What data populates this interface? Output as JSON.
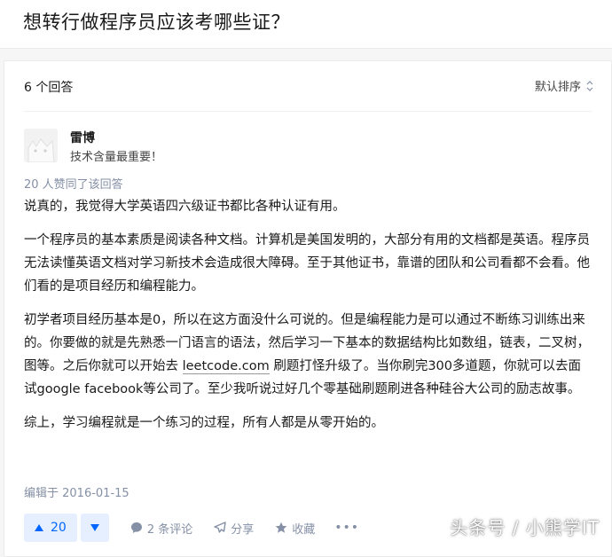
{
  "question": {
    "title": "想转行做程序员应该考哪些证？"
  },
  "answers_header": {
    "count_label": "6 个回答",
    "sort_label": "默认排序"
  },
  "answer": {
    "author": {
      "name": "雷博",
      "bio": "技术含量最重要！"
    },
    "votes_summary": "20 人赞同了该回答",
    "paragraphs": {
      "p1": "说真的，我觉得大学英语四六级证书都比各种认证有用。",
      "p2": "一个程序员的基本素质是阅读各种文档。计算机是美国发明的，大部分有用的文档都是英语。程序员无法读懂英语文档对学习新技术会造成很大障碍。至于其他证书，靠谱的团队和公司看都不会看。他们看的是项目经历和编程能力。",
      "p3_before_link": "初学者项目经历基本是0，所以在这方面没什么可说的。但是编程能力是可以通过不断练习训练出来的。你要做的就是先熟悉一门语言的语法，然后学习一下基本的数据结构比如数组，链表，二叉树，图等。之后你就可以开始去 ",
      "p3_link": "leetcode.com",
      "p3_after_link": " 刷题打怪升级了。当你刷完300多道题，你就可以去面试google facebook等公司了。至少我听说过好几个零基础刷题刷进各种硅谷大公司的励志故事。",
      "p4": "综上，学习编程就是一个练习的过程，所有人都是从零开始的。"
    },
    "edited": "编辑于 2016-01-15",
    "actions": {
      "upvote_count": "20",
      "comments": "2 条评论",
      "share": "分享",
      "collect": "收藏",
      "more": "•••"
    }
  },
  "watermark": "头条号 / 小熊学IT",
  "colors": {
    "accent": "#0066ff",
    "muted": "#8590a6",
    "vote_bg": "#e5efff"
  }
}
